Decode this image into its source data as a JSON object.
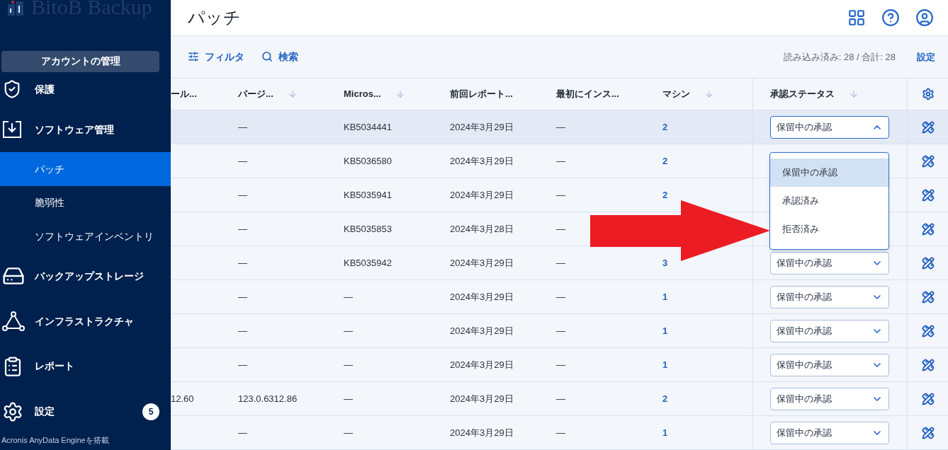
{
  "logo": {
    "text": "BitoB Backup"
  },
  "account_button": "アカウントの管理",
  "nav": [
    {
      "label": "保護",
      "kind": "section",
      "selected": false
    },
    {
      "label": "ソフトウェア管理",
      "kind": "section",
      "selected": false
    },
    {
      "label": "パッチ",
      "kind": "sub",
      "selected": true
    },
    {
      "label": "脆弱性",
      "kind": "sub",
      "selected": false
    },
    {
      "label": "ソフトウェアインベントリ",
      "kind": "sub",
      "selected": false
    },
    {
      "label": "バックアップストレージ",
      "kind": "section",
      "selected": false
    },
    {
      "label": "インフラストラクチャ",
      "kind": "section",
      "selected": false
    },
    {
      "label": "レポート",
      "kind": "section",
      "selected": false
    },
    {
      "label": "設定",
      "kind": "section",
      "selected": false,
      "badge": "5"
    }
  ],
  "footer": "Acronis AnyData Engineを搭載",
  "page_title": "パッチ",
  "toolbar": {
    "filter": "フィルタ",
    "search": "検索",
    "count": "読み込み済み: 28 / 合計: 28",
    "settings": "設定"
  },
  "table": {
    "columns": [
      {
        "label": "ール...",
        "sortable": false
      },
      {
        "label": "バージ...",
        "sortable": true
      },
      {
        "label": "Micros...",
        "sortable": true
      },
      {
        "label": "前回レポート...",
        "sortable": false
      },
      {
        "label": "最初にインス...",
        "sortable": false
      },
      {
        "label": "マシン",
        "sortable": true
      },
      {
        "label": "承認ステータス",
        "sortable": true
      }
    ],
    "rows": [
      {
        "cells": [
          "",
          "—",
          "KB5034441",
          "2024年3月29日",
          "—"
        ],
        "machines": "2",
        "status": "保留中の承認",
        "open": true,
        "selected": true
      },
      {
        "cells": [
          "",
          "—",
          "KB5036580",
          "2024年3月29日",
          "—"
        ],
        "machines": "2",
        "selected": false
      },
      {
        "cells": [
          "",
          "—",
          "KB5035941",
          "2024年3月29日",
          "—"
        ],
        "machines": "2",
        "selected": false
      },
      {
        "cells": [
          "",
          "—",
          "KB5035853",
          "2024年3月28日",
          "—"
        ],
        "selected": false
      },
      {
        "cells": [
          "",
          "—",
          "KB5035942",
          "2024年3月29日",
          "—"
        ],
        "machines": "3",
        "status": "保留中の承認",
        "open": false,
        "selected": false
      },
      {
        "cells": [
          "",
          "—",
          "—",
          "2024年3月29日",
          "—"
        ],
        "machines": "1",
        "status": "保留中の承認",
        "open": false,
        "selected": false
      },
      {
        "cells": [
          "",
          "—",
          "—",
          "2024年3月29日",
          "—"
        ],
        "machines": "1",
        "status": "保留中の承認",
        "open": false,
        "selected": false
      },
      {
        "cells": [
          "",
          "—",
          "—",
          "2024年3月29日",
          "—"
        ],
        "machines": "1",
        "status": "保留中の承認",
        "open": false,
        "selected": false
      },
      {
        "cells": [
          "12.60",
          "123.0.6312.86",
          "—",
          "2024年3月29日",
          "—"
        ],
        "machines": "2",
        "status": "保留中の承認",
        "open": false,
        "selected": false
      },
      {
        "cells": [
          "",
          "—",
          "—",
          "2024年3月29日",
          "—"
        ],
        "machines": "1",
        "status": "保留中の承認",
        "open": false,
        "selected": false
      }
    ]
  },
  "status_menu": {
    "options": [
      {
        "label": "保留中の承認",
        "selected": true
      },
      {
        "label": "承認済み",
        "selected": false
      },
      {
        "label": "拒否済み",
        "selected": false
      }
    ]
  }
}
